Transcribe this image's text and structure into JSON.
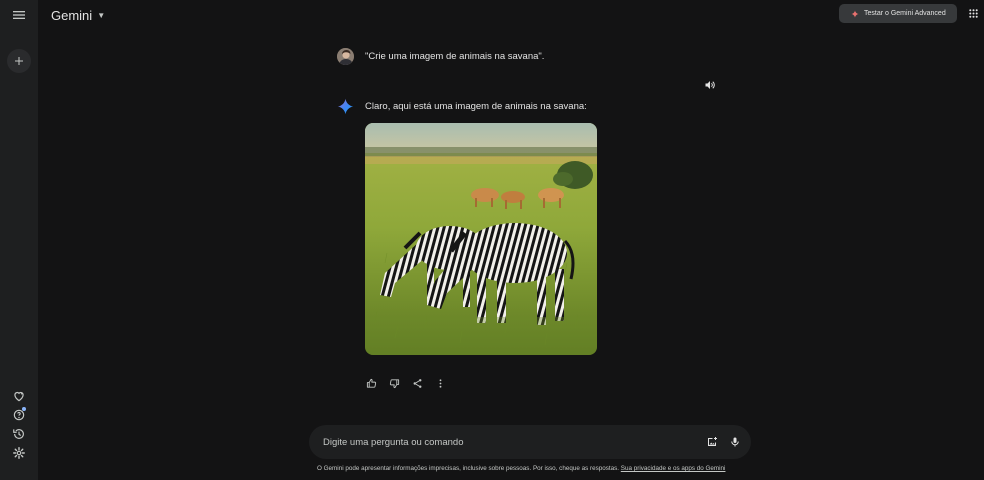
{
  "header": {
    "brand": "Gemini",
    "advanced_button_label": "Testar o Gemini Advanced"
  },
  "sidebar": {
    "menu_icon": "menu-icon",
    "new_chat_icon": "plus-icon",
    "bottom_icons": [
      "gem-heart-icon",
      "help-icon",
      "activity-icon",
      "settings-icon"
    ]
  },
  "conversation": {
    "user_prompt": "\"Crie uma imagem de animais na savana\".",
    "model_reply": "Claro, aqui está uma imagem de animais na savana:",
    "image_subject": "generated-image"
  },
  "actions": [
    "thumbs-up-icon",
    "thumbs-down-icon",
    "share-icon",
    "more-vert-icon"
  ],
  "prompt": {
    "placeholder": "Digite uma pergunta ou comando",
    "value": ""
  },
  "footer": {
    "disclaimer": "O Gemini pode apresentar informações imprecisas, inclusive sobre pessoas. Por isso, cheque as respostas.",
    "privacy_link": "Sua privacidade e os apps do Gemini"
  },
  "colors": {
    "background": "#131314",
    "sidebar": "#1e1f20",
    "accent_blue": "#4285f4",
    "text": "#e3e3e3"
  }
}
